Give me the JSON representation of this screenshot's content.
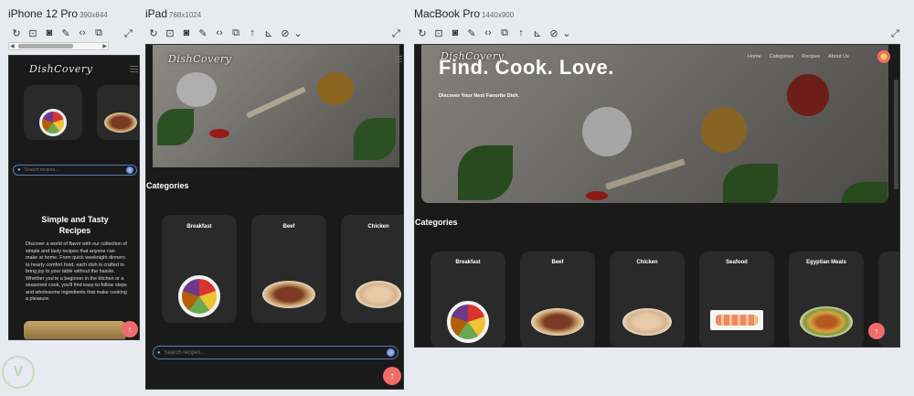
{
  "devices": [
    {
      "name": "iPhone 12 Pro",
      "dims": "390x844"
    },
    {
      "name": "iPad",
      "dims": "768x1024"
    },
    {
      "name": "MacBook Pro",
      "dims": "1440x900"
    }
  ],
  "toolbar_icons": [
    "refresh-icon",
    "screenshot-icon",
    "camera-icon",
    "pen-icon",
    "code-icon",
    "copy-icon",
    "rotate-icon",
    "ruler-icon",
    "eye-off-icon",
    "chevron-down-icon"
  ],
  "site": {
    "logo": "DishCovery",
    "logo_tag": "",
    "nav": [
      "Home",
      "Categories",
      "Recipes",
      "About Us"
    ],
    "hero_title": "Find. Cook. Love.",
    "hero_subtitle": "Discover Your Next Favorite Dish.",
    "search_placeholder": "Search recipes...",
    "categories_heading": "Categories",
    "categories": [
      "Breakfast",
      "Beef",
      "Chicken",
      "Seafood",
      "Egyptian Meals"
    ],
    "about_title": "Simple and Tasty Recipes",
    "about_text": "Discover a world of flavor with our collection of simple and tasty recipes that anyone can make at home. From quick weeknight dinners to hearty comfort food, each dish is crafted to bring joy to your table without the hassle. Whether you're a beginner in the kitchen or a seasoned cook, you'll find easy-to-follow steps and wholesome ingredients that make cooking a pleasure.",
    "up_arrow": "↑"
  },
  "colors": {
    "page_bg": "#1a1a1a",
    "card_bg": "#2a2a2a",
    "accent": "#f26b6b",
    "search_border": "#5a7bb5"
  }
}
